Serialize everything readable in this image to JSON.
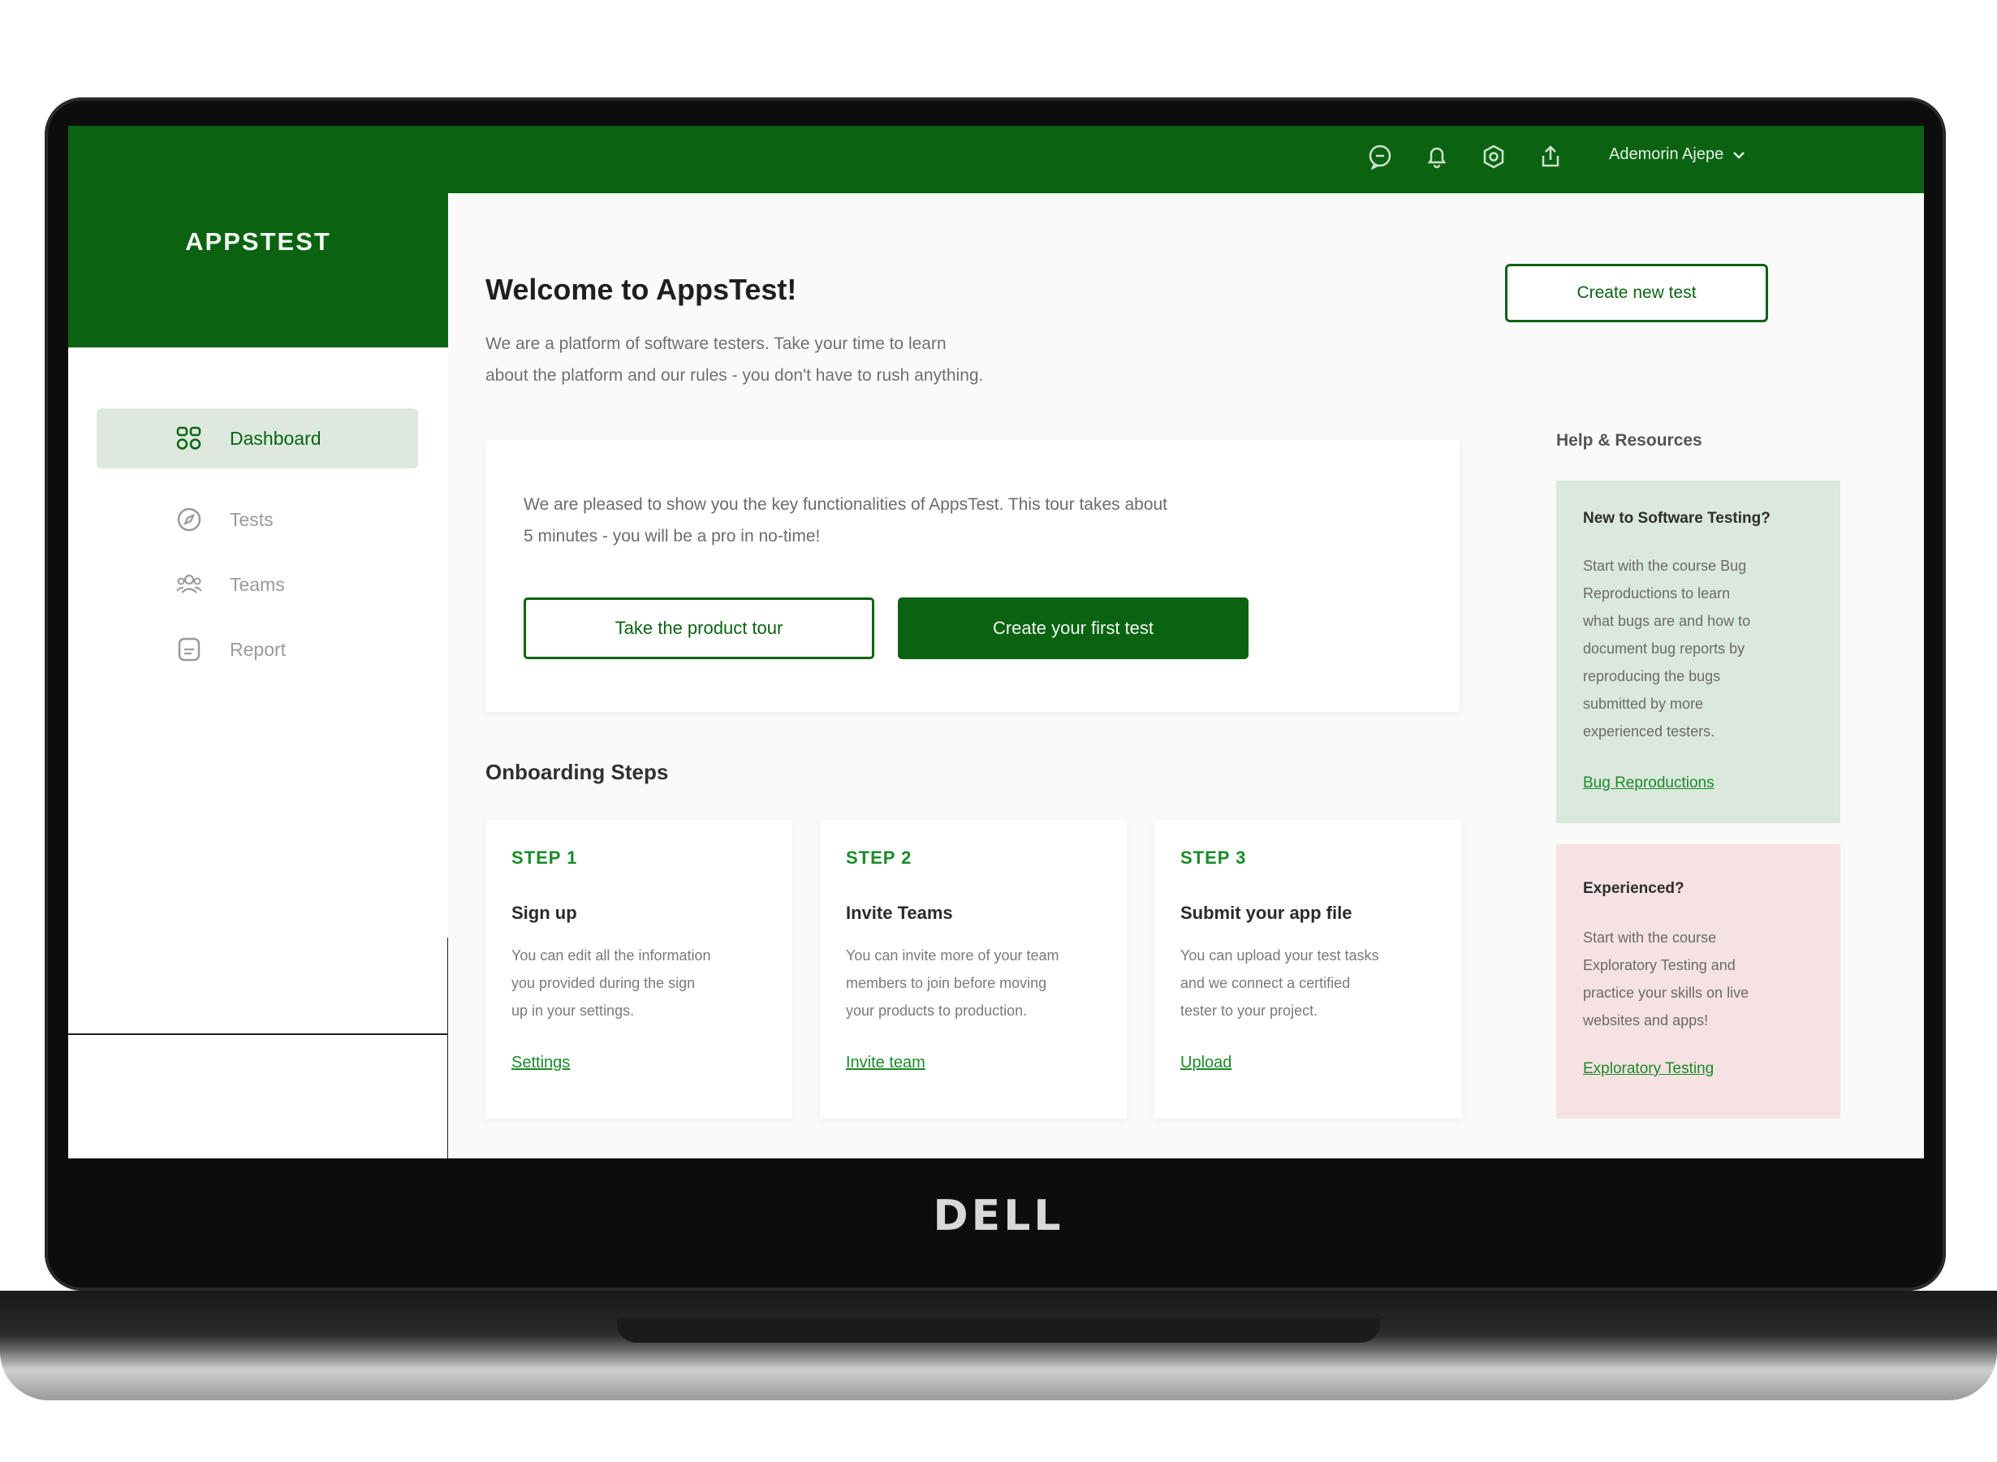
{
  "device": {
    "brand": "DELL"
  },
  "topbar": {
    "icons": [
      "chat-icon",
      "bell-icon",
      "settings-icon",
      "share-icon"
    ],
    "user_name": "Ademorin Ajepe"
  },
  "sidebar": {
    "brand": "APPSTEST",
    "items": [
      {
        "label": "Dashboard",
        "icon": "dashboard-icon",
        "active": true
      },
      {
        "label": "Tests",
        "icon": "compass-icon",
        "active": false
      },
      {
        "label": "Teams",
        "icon": "teams-icon",
        "active": false
      },
      {
        "label": "Report",
        "icon": "report-icon",
        "active": false
      }
    ]
  },
  "main": {
    "title": "Welcome to AppsTest!",
    "subtitle_line1": "We are a platform of software testers. Take your time to learn",
    "subtitle_line2": "about the platform and our rules - you don't have to rush anything.",
    "create_new_test": "Create new test",
    "tour": {
      "text_line1": "We are pleased to show you the key functionalities of AppsTest. This tour takes about",
      "text_line2": "5 minutes - you will be a pro in no-time!",
      "tour_button": "Take the product tour",
      "create_button": "Create your first test"
    },
    "onboarding_heading": "Onboarding Steps",
    "steps": [
      {
        "label": "STEP 1",
        "title": "Sign up",
        "desc_line1": "You can edit all the information",
        "desc_line2": "you provided during the sign",
        "desc_line3": "up in your settings.",
        "link": "Settings"
      },
      {
        "label": "STEP 2",
        "title": "Invite Teams",
        "desc_line1": "You can invite more of your team",
        "desc_line2": "members to join before moving",
        "desc_line3": "your products to production.",
        "link": "Invite team"
      },
      {
        "label": "STEP 3",
        "title": "Submit your app file",
        "desc_line1": "You can upload your test tasks",
        "desc_line2": "and we connect a certified",
        "desc_line3": "tester to your project.",
        "link": "Upload"
      }
    ]
  },
  "help": {
    "heading": "Help & Resources",
    "new_card": {
      "title": "New to Software Testing?",
      "lines": [
        "Start with the course Bug",
        "Reproductions to learn",
        "what bugs are and  how to",
        "document bug reports by",
        "reproducing the bugs",
        "submitted by more",
        "experienced testers."
      ],
      "link": "Bug Reproductions"
    },
    "experienced_card": {
      "title": "Experienced?",
      "lines": [
        "Start with the course",
        "Exploratory Testing and",
        "practice your skills on live",
        "websites and apps!"
      ],
      "link": "Exploratory Testing"
    }
  },
  "colors": {
    "brand_green": "#0b6312",
    "link_green": "#1a8a28",
    "help_green_bg": "#dbe8dd",
    "help_pink_bg": "#f6e2e2"
  }
}
